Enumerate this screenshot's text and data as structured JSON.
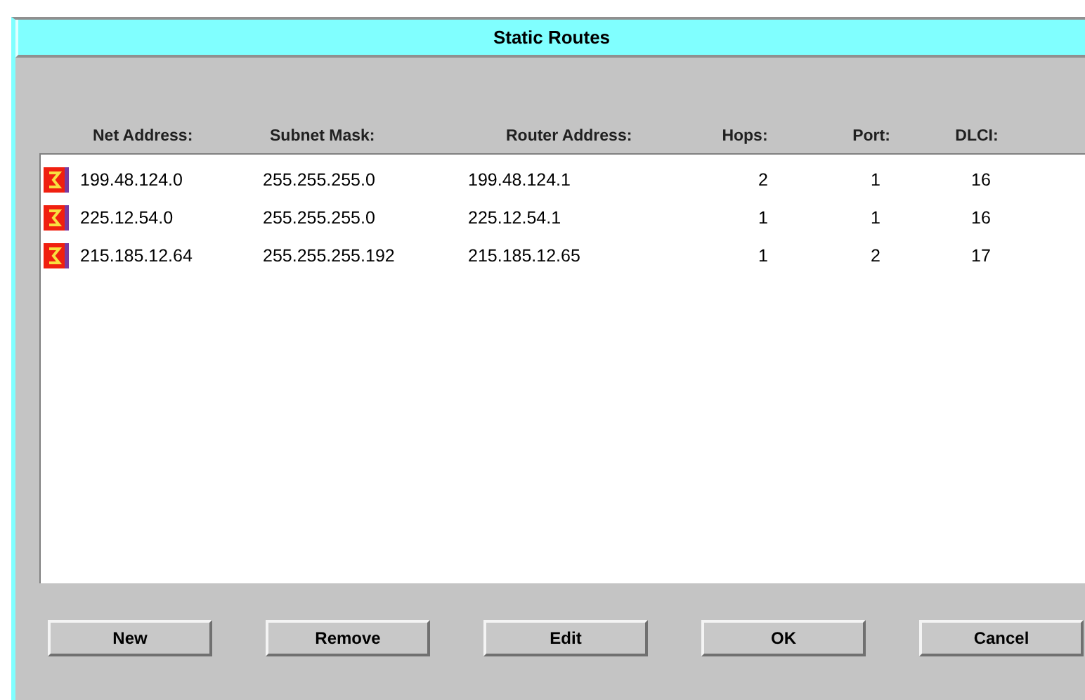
{
  "window": {
    "title": "Static Routes"
  },
  "table": {
    "columns": [
      "Net Address:",
      "Subnet Mask:",
      "Router Address:",
      "Hops:",
      "Port:",
      "DLCI:"
    ],
    "rows": [
      {
        "cells": [
          "199.48.124.0",
          "255.255.255.0",
          "199.48.124.1",
          "2",
          "1",
          "16"
        ]
      },
      {
        "cells": [
          "225.12.54.0",
          "255.255.255.0",
          "225.12.54.1",
          "1",
          "1",
          "16"
        ]
      },
      {
        "cells": [
          "215.185.12.64",
          "255.255.255.192",
          "215.185.12.65",
          "1",
          "2",
          "17"
        ]
      }
    ]
  },
  "buttons": [
    "New",
    "Remove",
    "Edit",
    "OK",
    "Cancel"
  ]
}
